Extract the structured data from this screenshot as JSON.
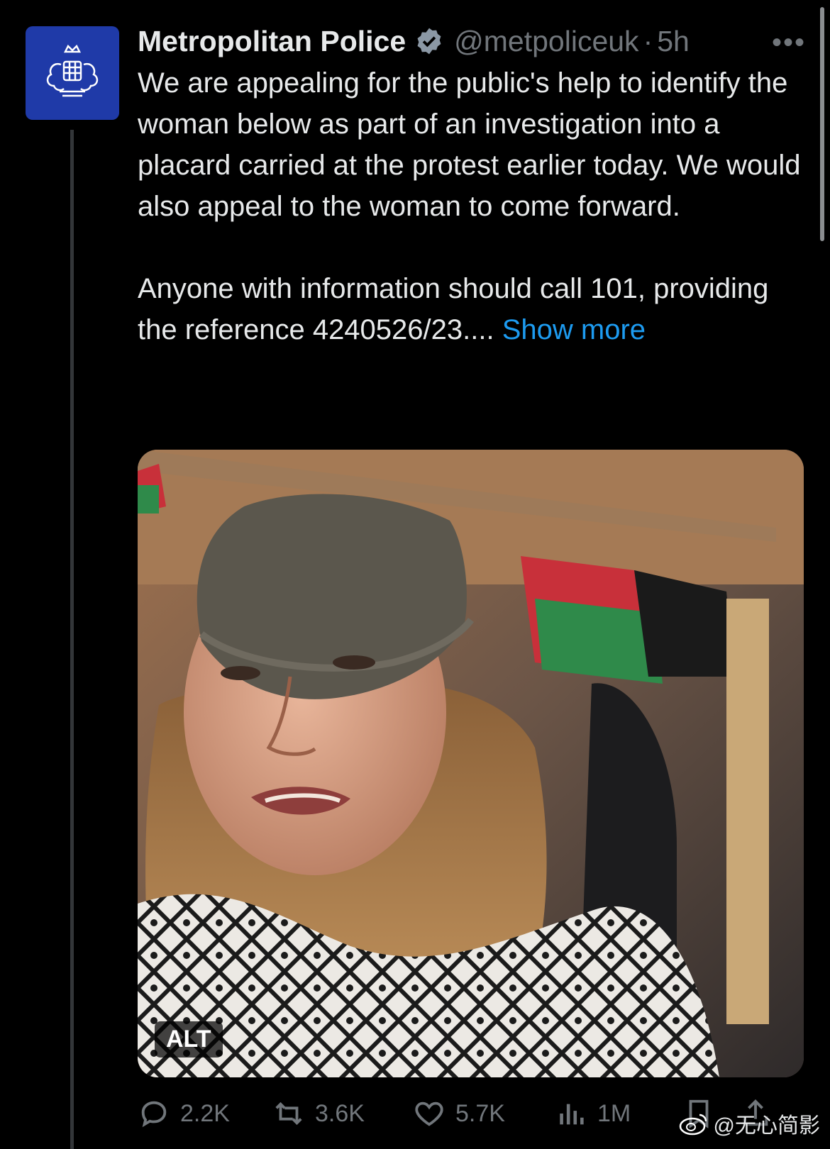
{
  "tweet": {
    "author_name": "Metropolitan Police",
    "handle": "@metpoliceuk",
    "separator": "·",
    "time": "5h",
    "more_label": "•••",
    "paragraph_1": "We are appealing for the public's help to identify the woman below as part of an investigation into a placard carried at the protest earlier today. We would also appeal to the woman to come forward.",
    "paragraph_2": "Anyone with information should call 101, providing the reference 4240526/23.... ",
    "show_more": "Show more",
    "media_alt_badge": "ALT"
  },
  "actions": {
    "replies": "2.2K",
    "reposts": "3.6K",
    "likes": "5.7K",
    "views": "1M"
  },
  "watermark": "@无心简影",
  "colors": {
    "background": "#000000",
    "text": "#e7e9ea",
    "muted": "#71767b",
    "link": "#1d9bf0",
    "avatar_bg": "#1f3aa8"
  },
  "icons": {
    "avatar": "police-crest-icon",
    "verified": "verified-badge-icon",
    "reply": "reply-icon",
    "repost": "repost-icon",
    "like": "heart-icon",
    "views": "views-bar-chart-icon",
    "bookmark": "bookmark-icon",
    "share": "share-icon"
  }
}
